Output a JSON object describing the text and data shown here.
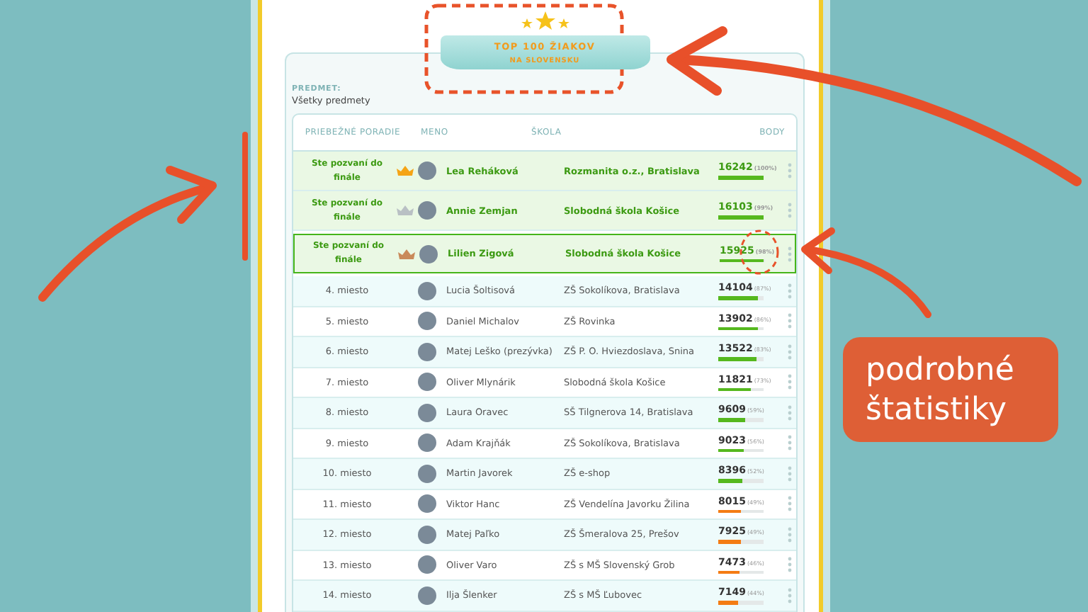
{
  "banner": {
    "title": "TOP 100 ŽIAKOV",
    "subtitle": "NA SLOVENSKU"
  },
  "filter": {
    "label": "PREDMET:",
    "value": "Všetky predmety"
  },
  "table": {
    "columns": [
      "PRIEBEŽNÉ PORADIE",
      "MENO",
      "ŠKOLA",
      "BODY"
    ],
    "rows": [
      {
        "rank": "Ste pozvaní do finále",
        "finalist": true,
        "selected": false,
        "crown": {
          "color": "#f5a416"
        },
        "name": "Lea Reháková",
        "school": "Rozmanita o.z., Bratislava",
        "points": "16242",
        "percent": "(100%)",
        "level": 1.0,
        "color": "#55b81e"
      },
      {
        "rank": "Ste pozvaní do finále",
        "finalist": true,
        "selected": false,
        "crown": {
          "color": "#b9c0c4"
        },
        "name": "Annie Zemjan",
        "school": "Slobodná škola Košice",
        "points": "16103",
        "percent": "(99%)",
        "level": 0.99,
        "color": "#55b81e"
      },
      {
        "rank": "Ste pozvaní do finále",
        "finalist": true,
        "selected": true,
        "crown": {
          "color": "#c98a5a"
        },
        "name": "Lilien Zigová",
        "school": "Slobodná škola Košice",
        "points": "15925",
        "percent": "(98%)",
        "level": 0.98,
        "color": "#55b81e"
      },
      {
        "rank": "4. miesto",
        "finalist": false,
        "selected": false,
        "name": "Lucia Šoltisová",
        "school": "ZŠ Sokolíkova, Bratislava",
        "points": "14104",
        "percent": "(87%)",
        "level": 0.87,
        "color": "#55b81e"
      },
      {
        "rank": "5. miesto",
        "finalist": false,
        "selected": false,
        "name": "Daniel Michalov",
        "school": "ZŠ Rovinka",
        "points": "13902",
        "percent": "(86%)",
        "level": 0.86,
        "color": "#55b81e"
      },
      {
        "rank": "6. miesto",
        "finalist": false,
        "selected": false,
        "name": "Matej Leško (prezývka)",
        "school": "ZŠ P. O. Hviezdoslava, Snina",
        "points": "13522",
        "percent": "(83%)",
        "level": 0.83,
        "color": "#55b81e"
      },
      {
        "rank": "7. miesto",
        "finalist": false,
        "selected": false,
        "name": "Oliver Mlynárik",
        "school": "Slobodná škola Košice",
        "points": "11821",
        "percent": "(73%)",
        "level": 0.73,
        "color": "#55b81e"
      },
      {
        "rank": "8. miesto",
        "finalist": false,
        "selected": false,
        "name": "Laura Oravec",
        "school": "SŠ Tilgnerova 14, Bratislava",
        "points": "9609",
        "percent": "(59%)",
        "level": 0.59,
        "color": "#55b81e"
      },
      {
        "rank": "9. miesto",
        "finalist": false,
        "selected": false,
        "name": "Adam Krajňák",
        "school": "ZŠ Sokolíkova, Bratislava",
        "points": "9023",
        "percent": "(56%)",
        "level": 0.56,
        "color": "#55b81e"
      },
      {
        "rank": "10. miesto",
        "finalist": false,
        "selected": false,
        "name": "Martin Javorek",
        "school": "ZŠ e-shop",
        "points": "8396",
        "percent": "(52%)",
        "level": 0.52,
        "color": "#55b81e"
      },
      {
        "rank": "11. miesto",
        "finalist": false,
        "selected": false,
        "name": "Viktor Hanc",
        "school": "ZŠ Vendelína Javorku Žilina",
        "points": "8015",
        "percent": "(49%)",
        "level": 0.49,
        "color": "#f47c14"
      },
      {
        "rank": "12. miesto",
        "finalist": false,
        "selected": false,
        "name": "Matej Paľko",
        "school": "ZŠ Šmeralova 25, Prešov",
        "points": "7925",
        "percent": "(49%)",
        "level": 0.49,
        "color": "#f47c14"
      },
      {
        "rank": "13. miesto",
        "finalist": false,
        "selected": false,
        "name": "Oliver Varo",
        "school": "ZŠ s MŠ Slovenský Grob",
        "points": "7473",
        "percent": "(46%)",
        "level": 0.46,
        "color": "#f47c14"
      },
      {
        "rank": "14. miesto",
        "finalist": false,
        "selected": false,
        "name": "Ilja Šlenker",
        "school": "ZŠ s MŠ Ľubovec",
        "points": "7149",
        "percent": "(44%)",
        "level": 0.44,
        "color": "#f47c14"
      }
    ]
  },
  "callout": {
    "text": "podrobné štatistiky"
  }
}
